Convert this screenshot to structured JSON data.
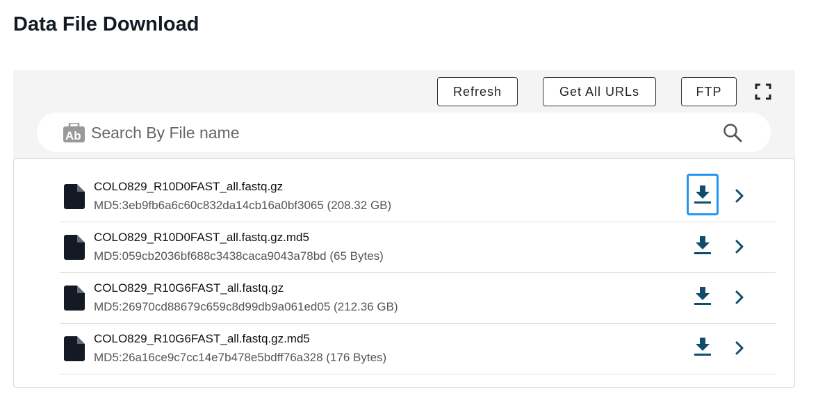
{
  "page": {
    "title": "Data File Download"
  },
  "toolbar": {
    "refresh_label": "Refresh",
    "get_all_urls_label": "Get All URLs",
    "ftp_label": "FTP",
    "fullscreen_icon": "fullscreen-icon"
  },
  "search": {
    "placeholder": "Search By File name",
    "value": "",
    "type_icon": "text-search-icon",
    "search_icon": "magnifier-icon"
  },
  "colors": {
    "accent": "#0f4c6e",
    "focus_ring": "#2196f3",
    "file_icon": "#131a24",
    "panel_bg": "#f4f4f4"
  },
  "files": [
    {
      "name": "COLO829_R10D0FAST_all.fastq.gz",
      "meta": "MD5:3eb9fb6a6c60c832da14cb16a0bf3065 (208.32 GB)",
      "download_focused": true
    },
    {
      "name": "COLO829_R10D0FAST_all.fastq.gz.md5",
      "meta": "MD5:059cb2036bf688c3438caca9043a78bd (65 Bytes)",
      "download_focused": false
    },
    {
      "name": "COLO829_R10G6FAST_all.fastq.gz",
      "meta": "MD5:26970cd88679c659c8d99db9a061ed05 (212.36 GB)",
      "download_focused": false
    },
    {
      "name": "COLO829_R10G6FAST_all.fastq.gz.md5",
      "meta": "MD5:26a16ce9c7cc14e7b478e5bdff76a328 (176 Bytes)",
      "download_focused": false
    }
  ]
}
